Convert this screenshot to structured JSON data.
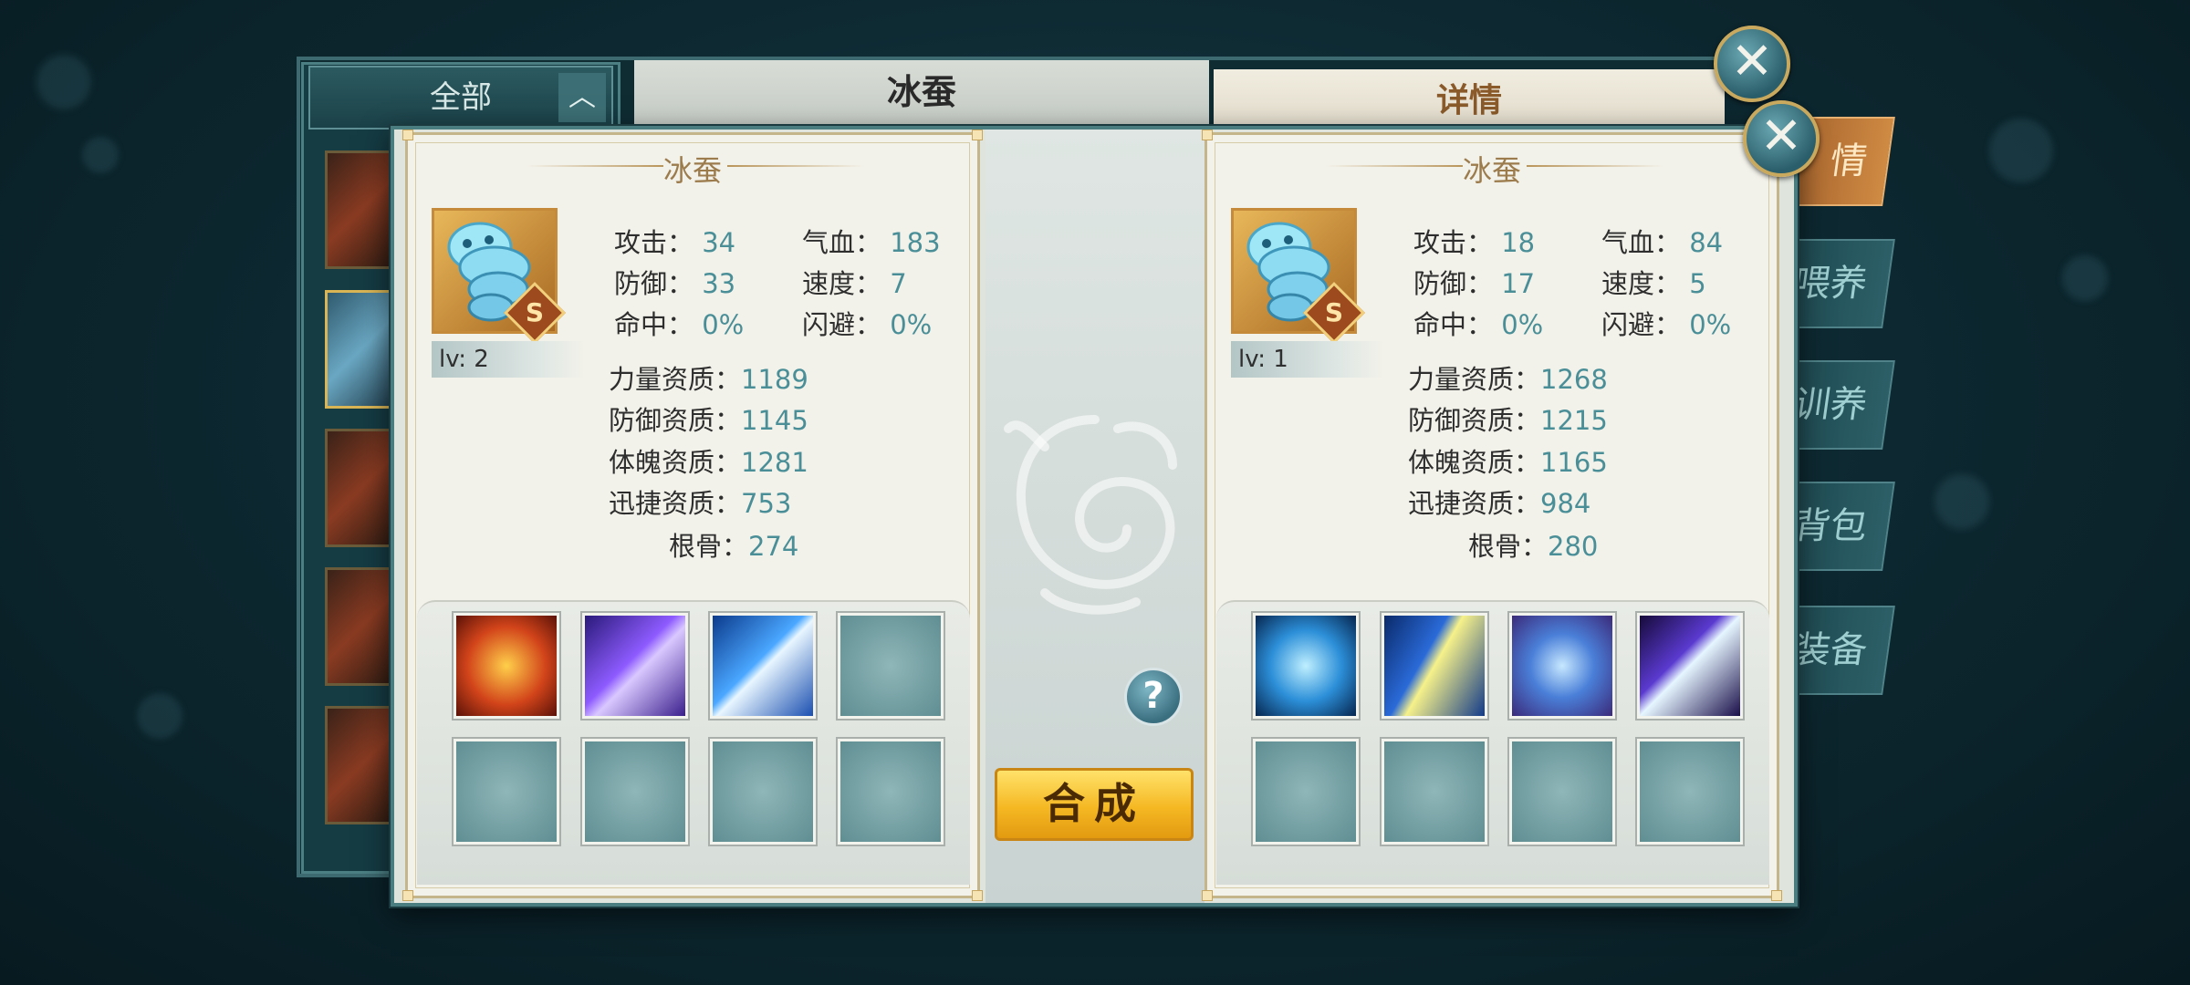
{
  "colors": {
    "accent_gold": "#f5b823",
    "value_teal": "#4a8f98",
    "panel_bg": "#f3f2ea"
  },
  "background": {
    "list_header": "全部",
    "list_toggle_icon": "chevron-up-icon",
    "center_title": "冰蚕",
    "right_header": "详情",
    "side_tabs": [
      "情",
      "喂养",
      "训养",
      "背包",
      "装备"
    ]
  },
  "left": {
    "name": "冰蚕",
    "rank": "S",
    "level": "lv: 2",
    "stats": [
      {
        "label": "攻击：",
        "value": "34"
      },
      {
        "label": "气血：",
        "value": "183"
      },
      {
        "label": "防御：",
        "value": "33"
      },
      {
        "label": "速度：",
        "value": "7"
      },
      {
        "label": "命中：",
        "value": "0%"
      },
      {
        "label": "闪避：",
        "value": "0%"
      }
    ],
    "aptitudes": [
      {
        "label": "力量资质：",
        "value": "1189"
      },
      {
        "label": "防御资质：",
        "value": "1145"
      },
      {
        "label": "体魄资质：",
        "value": "1281"
      },
      {
        "label": "迅捷资质：",
        "value": "753"
      },
      {
        "label": "根骨：",
        "value": "274"
      }
    ],
    "skills": [
      "fire-orb-skill-icon",
      "purple-slash-skill-icon",
      "lightning-arrow-skill-icon",
      "empty-slot",
      "empty-slot",
      "empty-slot",
      "empty-slot",
      "empty-slot"
    ]
  },
  "right": {
    "name": "冰蚕",
    "rank": "S",
    "level": "lv: 1",
    "stats": [
      {
        "label": "攻击：",
        "value": "18"
      },
      {
        "label": "气血：",
        "value": "84"
      },
      {
        "label": "防御：",
        "value": "17"
      },
      {
        "label": "速度：",
        "value": "5"
      },
      {
        "label": "命中：",
        "value": "0%"
      },
      {
        "label": "闪避：",
        "value": "0%"
      }
    ],
    "aptitudes": [
      {
        "label": "力量资质：",
        "value": "1268"
      },
      {
        "label": "防御资质：",
        "value": "1215"
      },
      {
        "label": "体魄资质：",
        "value": "1165"
      },
      {
        "label": "迅捷资质：",
        "value": "984"
      },
      {
        "label": "根骨：",
        "value": "280"
      }
    ],
    "skills": [
      "crossed-blades-skill-icon",
      "light-beam-skill-icon",
      "shield-skill-icon",
      "claw-slash-skill-icon",
      "empty-slot",
      "empty-slot",
      "empty-slot",
      "empty-slot"
    ]
  },
  "actions": {
    "synthesize_label": "合成",
    "help_label": "?",
    "close_label": "✕"
  }
}
